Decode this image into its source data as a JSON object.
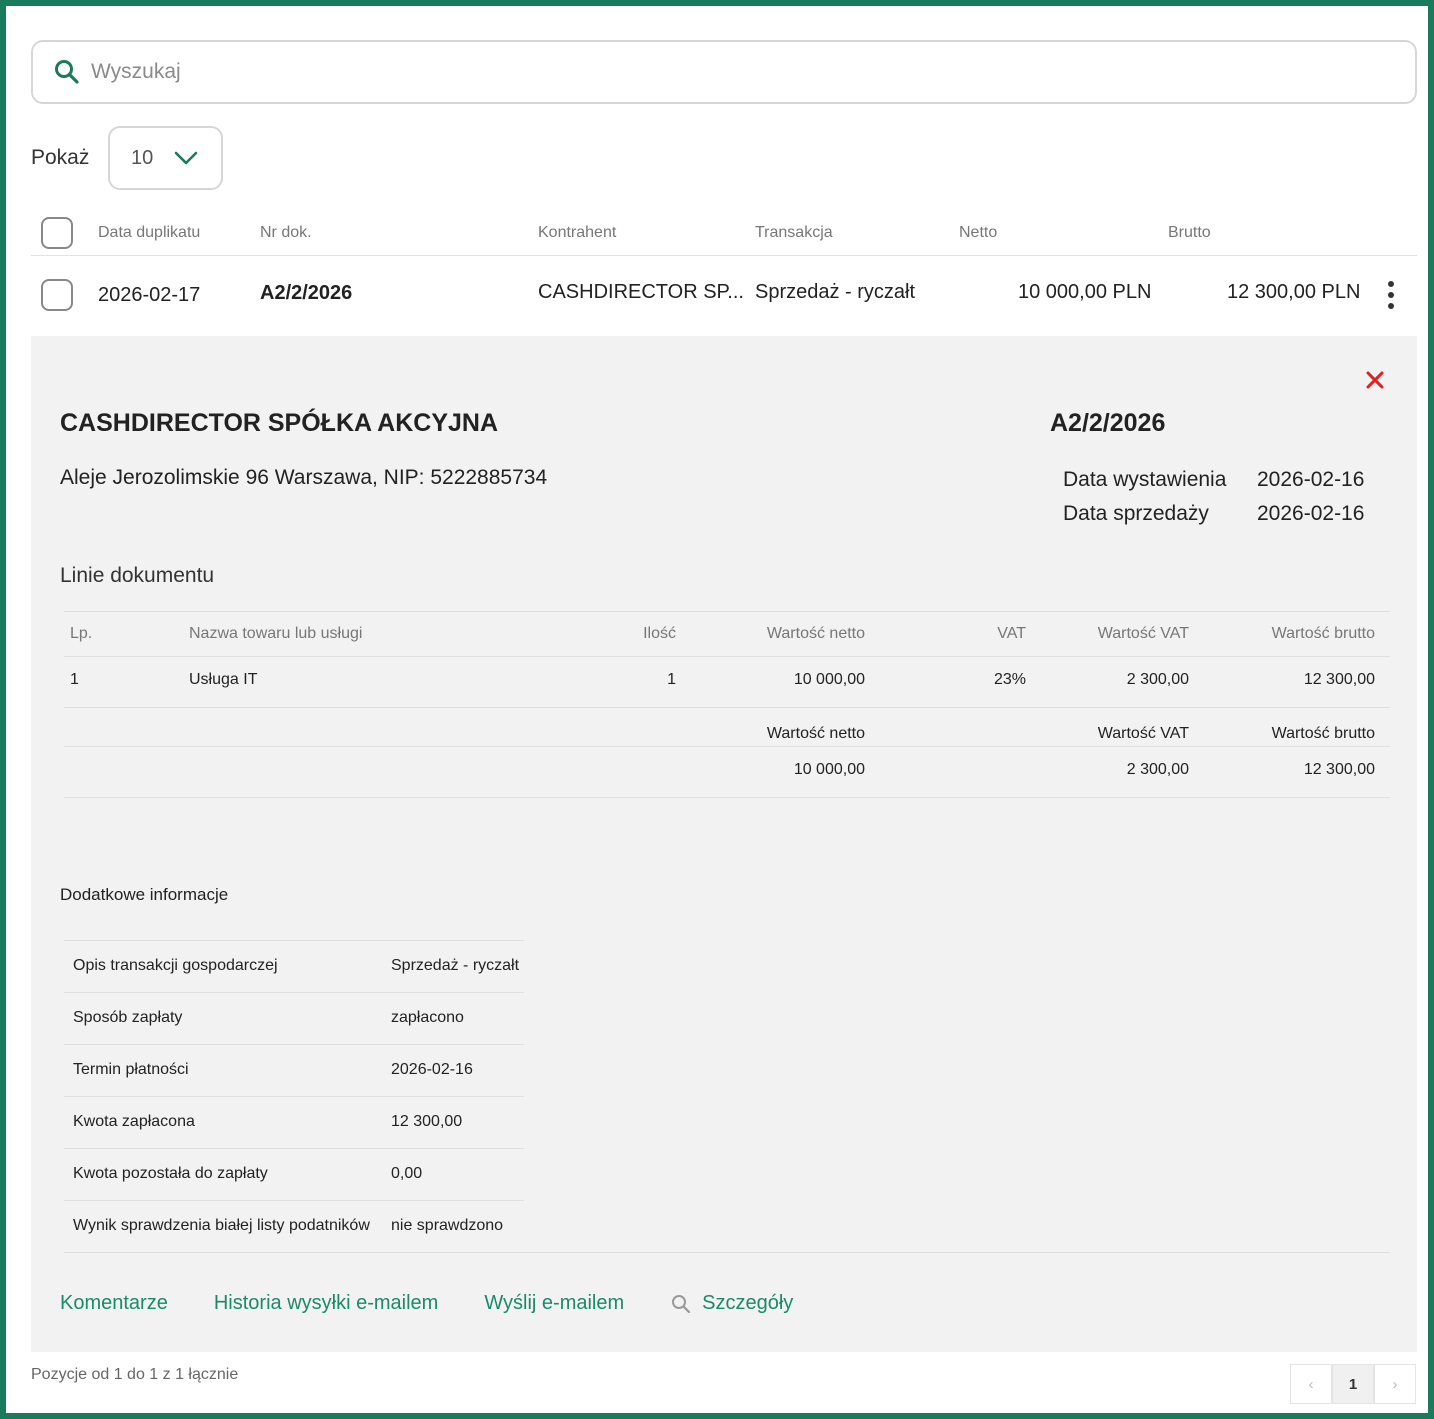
{
  "search": {
    "placeholder": "Wyszukaj",
    "icon": "search-icon"
  },
  "page_size": {
    "label": "Pokaż",
    "value": "10",
    "icon": "chevron-down-icon"
  },
  "table": {
    "headers": [
      "Data duplikatu",
      "Nr dok.",
      "Kontrahent",
      "Transakcja",
      "Netto",
      "Brutto"
    ],
    "row": {
      "date": "2026-02-17",
      "doc_no": "A2/2/2026",
      "contractor": "CASHDIRECTOR SP...",
      "transaction": "Sprzedaż - ryczałt",
      "net": "10 000,00 PLN",
      "gross": "12 300,00 PLN"
    }
  },
  "details": {
    "company": "CASHDIRECTOR SPÓŁKA AKCYJNA",
    "address": "Aleje Jerozolimskie 96 Warszawa, NIP: 5222885734",
    "doc_no": "A2/2/2026",
    "issue_date_label": "Data wystawienia",
    "issue_date": "2026-02-16",
    "sale_date_label": "Data sprzedaży",
    "sale_date": "2026-02-16",
    "lines_title": "Linie dokumentu",
    "lines_headers": {
      "lp": "Lp.",
      "name": "Nazwa towaru lub usługi",
      "qty": "Ilość",
      "net": "Wartość netto",
      "vat": "VAT",
      "vat_value": "Wartość VAT",
      "gross": "Wartość brutto"
    },
    "line": {
      "lp": "1",
      "name": "Usługa IT",
      "qty": "1",
      "net": "10 000,00",
      "vat": "23%",
      "vat_value": "2 300,00",
      "gross": "12 300,00"
    },
    "totals_headers": {
      "net": "Wartość netto",
      "vat_value": "Wartość VAT",
      "gross": "Wartość brutto"
    },
    "totals": {
      "net": "10 000,00",
      "vat_value": "2 300,00",
      "gross": "12 300,00"
    },
    "additional_title": "Dodatkowe informacje",
    "additional": [
      {
        "key": "Opis transakcji gospodarczej",
        "value": "Sprzedaż - ryczałt"
      },
      {
        "key": "Sposób zapłaty",
        "value": "zapłacono"
      },
      {
        "key": "Termin płatności",
        "value": "2026-02-16"
      },
      {
        "key": "Kwota zapłacona",
        "value": "12 300,00"
      },
      {
        "key": "Kwota pozostała do zapłaty",
        "value": "0,00"
      },
      {
        "key": "Wynik sprawdzenia białej listy podatników",
        "value": "nie sprawdzono"
      }
    ],
    "actions": {
      "comments": "Komentarze",
      "email_history": "Historia wysyłki e-mailem",
      "send_email": "Wyślij e-mailem",
      "details": "Szczegóły"
    }
  },
  "footer": {
    "summary": "Pozycje od 1 do 1 z 1 łącznie",
    "current_page": "1",
    "prev_symbol": "‹",
    "next_symbol": "›"
  },
  "colors": {
    "accent": "#1a8a6a",
    "frame": "#1a7a5c",
    "close": "#e02020",
    "panel": "#f2f2f2"
  }
}
